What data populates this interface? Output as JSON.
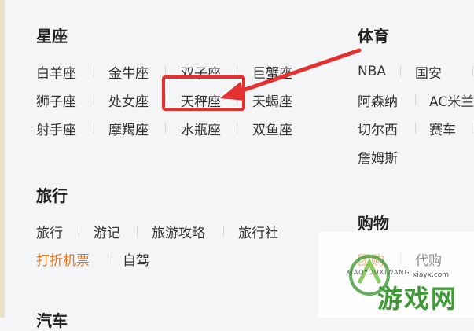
{
  "left": {
    "constellation": {
      "title": "星座",
      "rows": [
        [
          "白羊座",
          "金牛座",
          "双子座",
          "巨蟹座"
        ],
        [
          "狮子座",
          "处女座",
          "天秤座",
          "天蝎座"
        ],
        [
          "射手座",
          "摩羯座",
          "水瓶座",
          "双鱼座"
        ]
      ]
    },
    "travel": {
      "title": "旅行",
      "row1": [
        "旅行",
        "游记",
        "旅游攻略",
        "旅行社"
      ],
      "row2": [
        "打折机票",
        "自驾"
      ]
    },
    "next_heading": "汽车"
  },
  "right": {
    "sports": {
      "title": "体育",
      "row1": [
        "NBA",
        "国安"
      ],
      "row2": [
        "阿森纳",
        "AC米兰"
      ],
      "row3": [
        "切尔西",
        "赛车"
      ],
      "row4": [
        "詹姆斯"
      ]
    },
    "shopping": {
      "title": "购物",
      "row1": [
        "团购",
        "代购"
      ]
    }
  },
  "watermark": {
    "brand": "游戏网",
    "url": "xiayx.com",
    "pinyin": "XIAOYOUXIWANG"
  },
  "colors": {
    "accent_orange": "#e8771c",
    "annotation_red": "#e53030",
    "watermark_green": "#3d9a35"
  }
}
